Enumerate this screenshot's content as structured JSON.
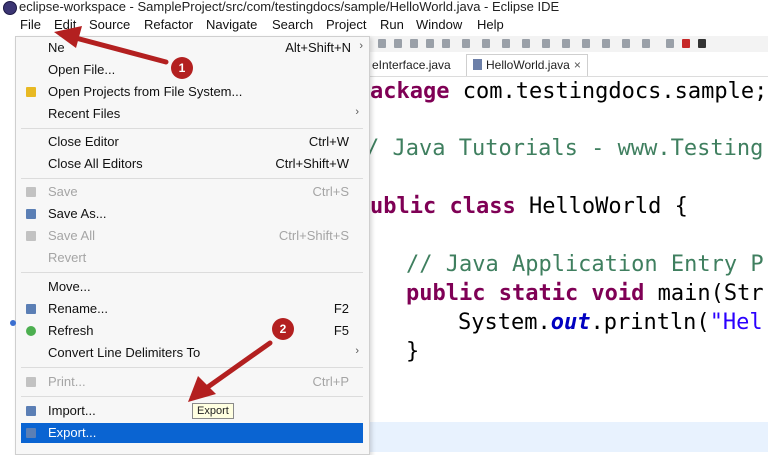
{
  "window": {
    "title": "eclipse-workspace - SampleProject/src/com/testingdocs/sample/HelloWorld.java - Eclipse IDE"
  },
  "menubar": {
    "items": [
      "File",
      "Edit",
      "Source",
      "Refactor",
      "Navigate",
      "Search",
      "Project",
      "Run",
      "Window",
      "Help"
    ]
  },
  "tabs": [
    {
      "label": "eInterface.java"
    },
    {
      "label": "HelloWorld.java",
      "close": "×"
    }
  ],
  "file_menu": {
    "items": [
      {
        "label": "Ne",
        "shortcut": "Alt+Shift+N",
        "submenu": "›"
      },
      {
        "label": "Open File..."
      },
      {
        "label": "Open Projects from File System..."
      },
      {
        "label": "Recent Files",
        "submenu": "›"
      },
      {
        "label": "Close Editor",
        "shortcut": "Ctrl+W"
      },
      {
        "label": "Close All Editors",
        "shortcut": "Ctrl+Shift+W"
      },
      {
        "label": "Save",
        "shortcut": "Ctrl+S",
        "disabled": true
      },
      {
        "label": "Save As..."
      },
      {
        "label": "Save All",
        "shortcut": "Ctrl+Shift+S",
        "disabled": true
      },
      {
        "label": "Revert",
        "disabled": true
      },
      {
        "label": "Move..."
      },
      {
        "label": "Rename...",
        "shortcut": "F2"
      },
      {
        "label": "Refresh",
        "shortcut": "F5"
      },
      {
        "label": "Convert Line Delimiters To",
        "submenu": "›"
      },
      {
        "label": "Print...",
        "shortcut": "Ctrl+P",
        "disabled": true
      },
      {
        "label": "Import..."
      },
      {
        "label": "Export...",
        "selected": true
      }
    ]
  },
  "tooltip": "Export",
  "editor": {
    "line1_kw": "ackage",
    "line1_rest": " com.testingdocs.sample;",
    "line2": "/ Java Tutorials - www.Testing",
    "line3_kw": "ublic class",
    "line3_rest": " HelloWorld {",
    "line4": "// Java Application Entry P",
    "line5_kw": "public static void",
    "line5_rest": " main(Str",
    "line6_a": "System.",
    "line6_field": "out",
    "line6_b": ".println(",
    "line6_str": "\"Hel",
    "line7": "}"
  },
  "annotations": {
    "badge1": "1",
    "badge2": "2"
  },
  "colors": {
    "menu_selection": "#0a64d2",
    "annotation_red": "#b32020",
    "keyword": "#7f0055",
    "comment": "#3f7f5f",
    "string": "#2a00ff"
  }
}
